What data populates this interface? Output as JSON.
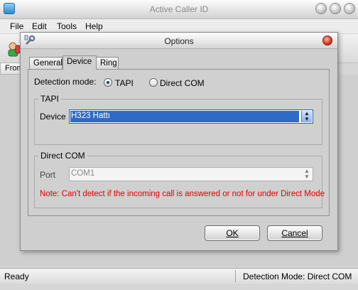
{
  "app": {
    "title": "Active Caller ID",
    "menu": [
      "File",
      "Edit",
      "Tools",
      "Help"
    ],
    "column_header": "From"
  },
  "status": {
    "left": "Ready",
    "right": "Detection Mode: Direct COM"
  },
  "dialog": {
    "title": "Options",
    "tabs": [
      {
        "label": "General"
      },
      {
        "label": "Device",
        "active": true
      },
      {
        "label": "Ring"
      }
    ],
    "detection_mode": {
      "label": "Detection mode:",
      "options": [
        "TAPI",
        "Direct COM"
      ],
      "selected": "TAPI"
    },
    "tapi_group": {
      "title": "TAPI",
      "device_label": "Device",
      "device_value": "H323 Hattı"
    },
    "direct_com_group": {
      "title": "Direct COM",
      "port_label": "Port",
      "port_value": "COM1",
      "note": "Note: Can't detect if the incoming call is answered or not for under Direct Mode"
    },
    "buttons": {
      "ok": "OK",
      "cancel": "Cancel"
    }
  },
  "colors": {
    "note_text": "#e00000",
    "selection": "#2f6ac8",
    "disabled_text": "#8a8a8a"
  }
}
